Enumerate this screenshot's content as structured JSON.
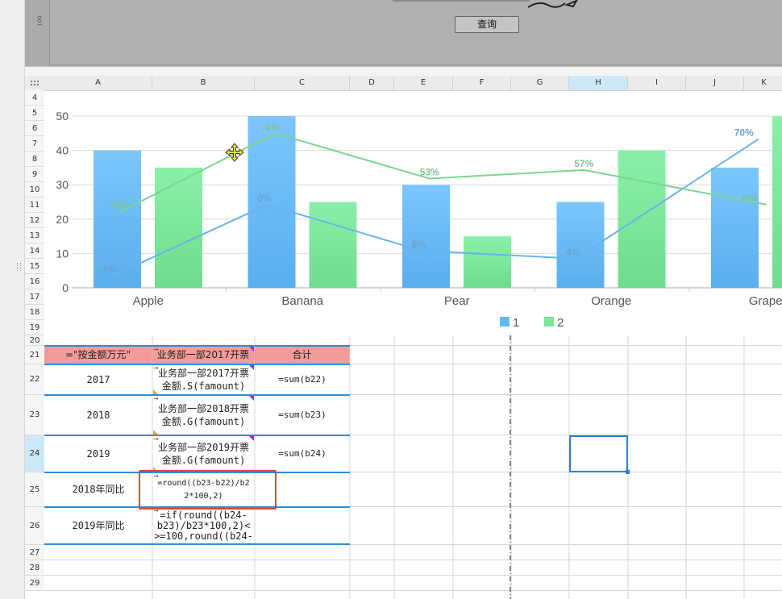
{
  "toolbar": {
    "query_label": "查询",
    "ruler_label": "100"
  },
  "columns": [
    "A",
    "B",
    "C",
    "D",
    "E",
    "F",
    "G",
    "H",
    "I",
    "J",
    "K"
  ],
  "selected_column": "H",
  "rows": [
    "4",
    "5",
    "6",
    "7",
    "8",
    "9",
    "10",
    "11",
    "12",
    "13",
    "14",
    "15",
    "16",
    "17",
    "18",
    "19",
    "20",
    "21",
    "22",
    "23",
    "24",
    "25",
    "26",
    "27",
    "28",
    "29"
  ],
  "selected_row": "24",
  "chart_data": {
    "type": "bar",
    "categories": [
      "Apple",
      "Banana",
      "Pear",
      "Orange",
      "Grape"
    ],
    "series": [
      {
        "name": "1",
        "values": [
          40,
          50,
          30,
          25,
          35
        ],
        "color": "#66b8f3"
      },
      {
        "name": "2",
        "values": [
          35,
          25,
          15,
          40,
          50
        ],
        "color": "#7de49a"
      }
    ],
    "lines": [
      {
        "values": [
          3.5,
          24.2,
          10.8,
          8.5,
          43.3
        ],
        "color": "#6ab3ea",
        "labels": [
          "5%",
          "0%",
          "8%",
          "4%",
          "70%"
        ]
      },
      {
        "values": [
          22.2,
          45,
          31.8,
          34.3,
          24.2
        ],
        "color": "#7dd592",
        "labels": [
          "36%",
          "5%",
          "53%",
          "57%",
          "0%"
        ]
      }
    ],
    "y_ticks": [
      "0",
      "10",
      "20",
      "30",
      "40",
      "50"
    ],
    "ylim": [
      0,
      50
    ],
    "legend_position": "bottom"
  },
  "table": {
    "header": [
      "=\"按金额万元\"",
      "业务部一部2017开票",
      "合计"
    ],
    "rows": [
      {
        "a": "2017",
        "b1": "业务部一部2017开票",
        "b2": "金额.S(famount)",
        "c": "=sum(b22)"
      },
      {
        "a": "2018",
        "b1": "业务部一部2018开票",
        "b2": "金额.G(famount)",
        "c": "=sum(b23)"
      },
      {
        "a": "2019",
        "b1": "业务部一部2019开票",
        "b2": "金额.G(famount)",
        "c": "=sum(b24)"
      },
      {
        "a": "2018年同比",
        "b1": "=round((b23-b22)/b2",
        "b2": "2*100,2)",
        "c": ""
      },
      {
        "a": "2019年同比",
        "b1": "=if(round((b24-",
        "b2": "b23)/b23*100,2)<",
        "b3": ">=100,round((b24-",
        "c": ""
      }
    ]
  },
  "colors": {
    "header_fill": "#f29b9b",
    "accent_blue": "#2a8fd8",
    "highlight_red": "#e0423b"
  }
}
